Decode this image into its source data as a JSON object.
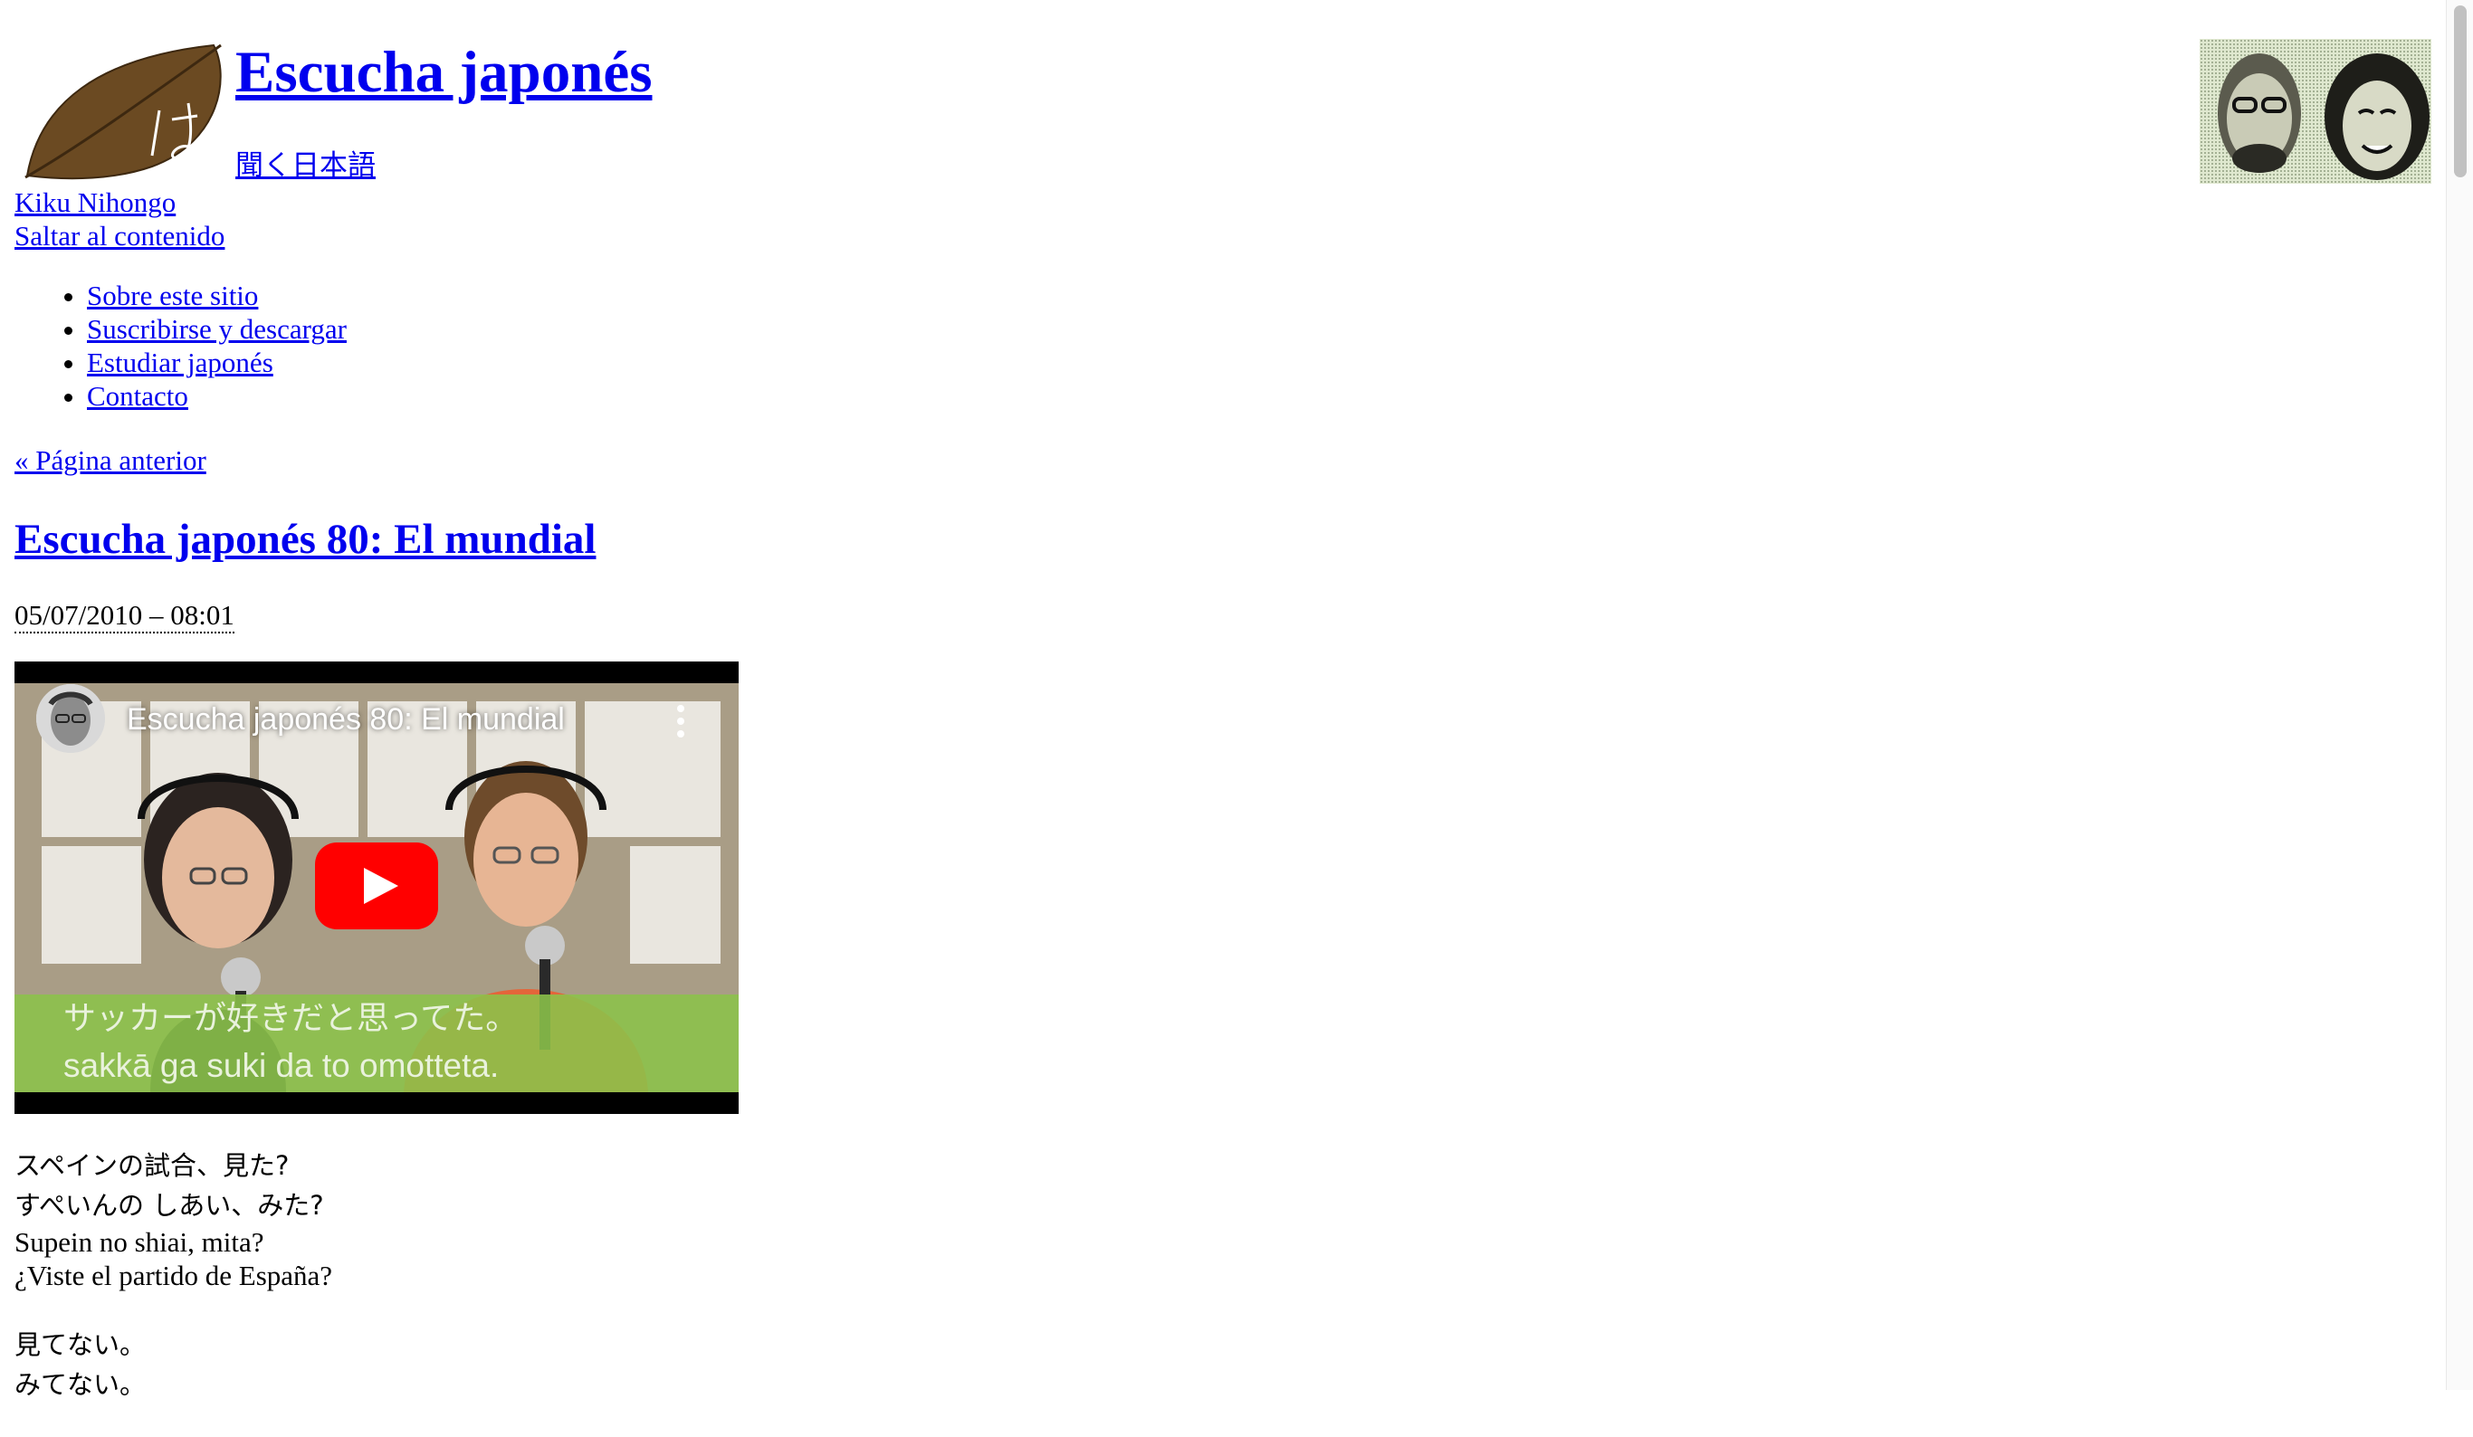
{
  "header": {
    "logo_icon": "leaf-ha-logo-icon",
    "title": "Escucha japonés",
    "subtitle_jp": "聞く日本語",
    "kiku": "Kiku Nihongo",
    "skip_link": "Saltar al contenido",
    "avatar_icon": "hosts-portrait-icon"
  },
  "nav": {
    "items": [
      {
        "label": "Sobre este sitio"
      },
      {
        "label": "Suscribirse y descargar"
      },
      {
        "label": "Estudiar japonés"
      },
      {
        "label": "Contacto"
      }
    ]
  },
  "prev_page": "« Página anterior",
  "post": {
    "title": "Escucha japonés 80: El mundial",
    "date": "05/07/2010 – 08:01"
  },
  "video": {
    "title": "Escucha japonés 80: El mundial",
    "subtitle_jp": "サッカーが好きだと思ってた。",
    "subtitle_romaji": "sakkā ga suki da to omotteta.",
    "play_icon": "youtube-play-icon",
    "menu_icon": "more-vert-icon",
    "channel_icon": "channel-avatar-icon"
  },
  "dialogue": [
    {
      "kanji": "スペインの試合、見た?",
      "kana": "すぺいんの しあい、みた?",
      "romaji": "Supein no shiai, mita?",
      "spanish": "¿Viste el partido de España?"
    },
    {
      "kanji": "見てない。",
      "kana": "みてない。",
      "romaji": "",
      "spanish": ""
    }
  ],
  "colors": {
    "link": "#0000ee",
    "leaf": "#6b4a22",
    "youtube_red": "#ff0000",
    "subtitle_band": "#8bc34a"
  }
}
